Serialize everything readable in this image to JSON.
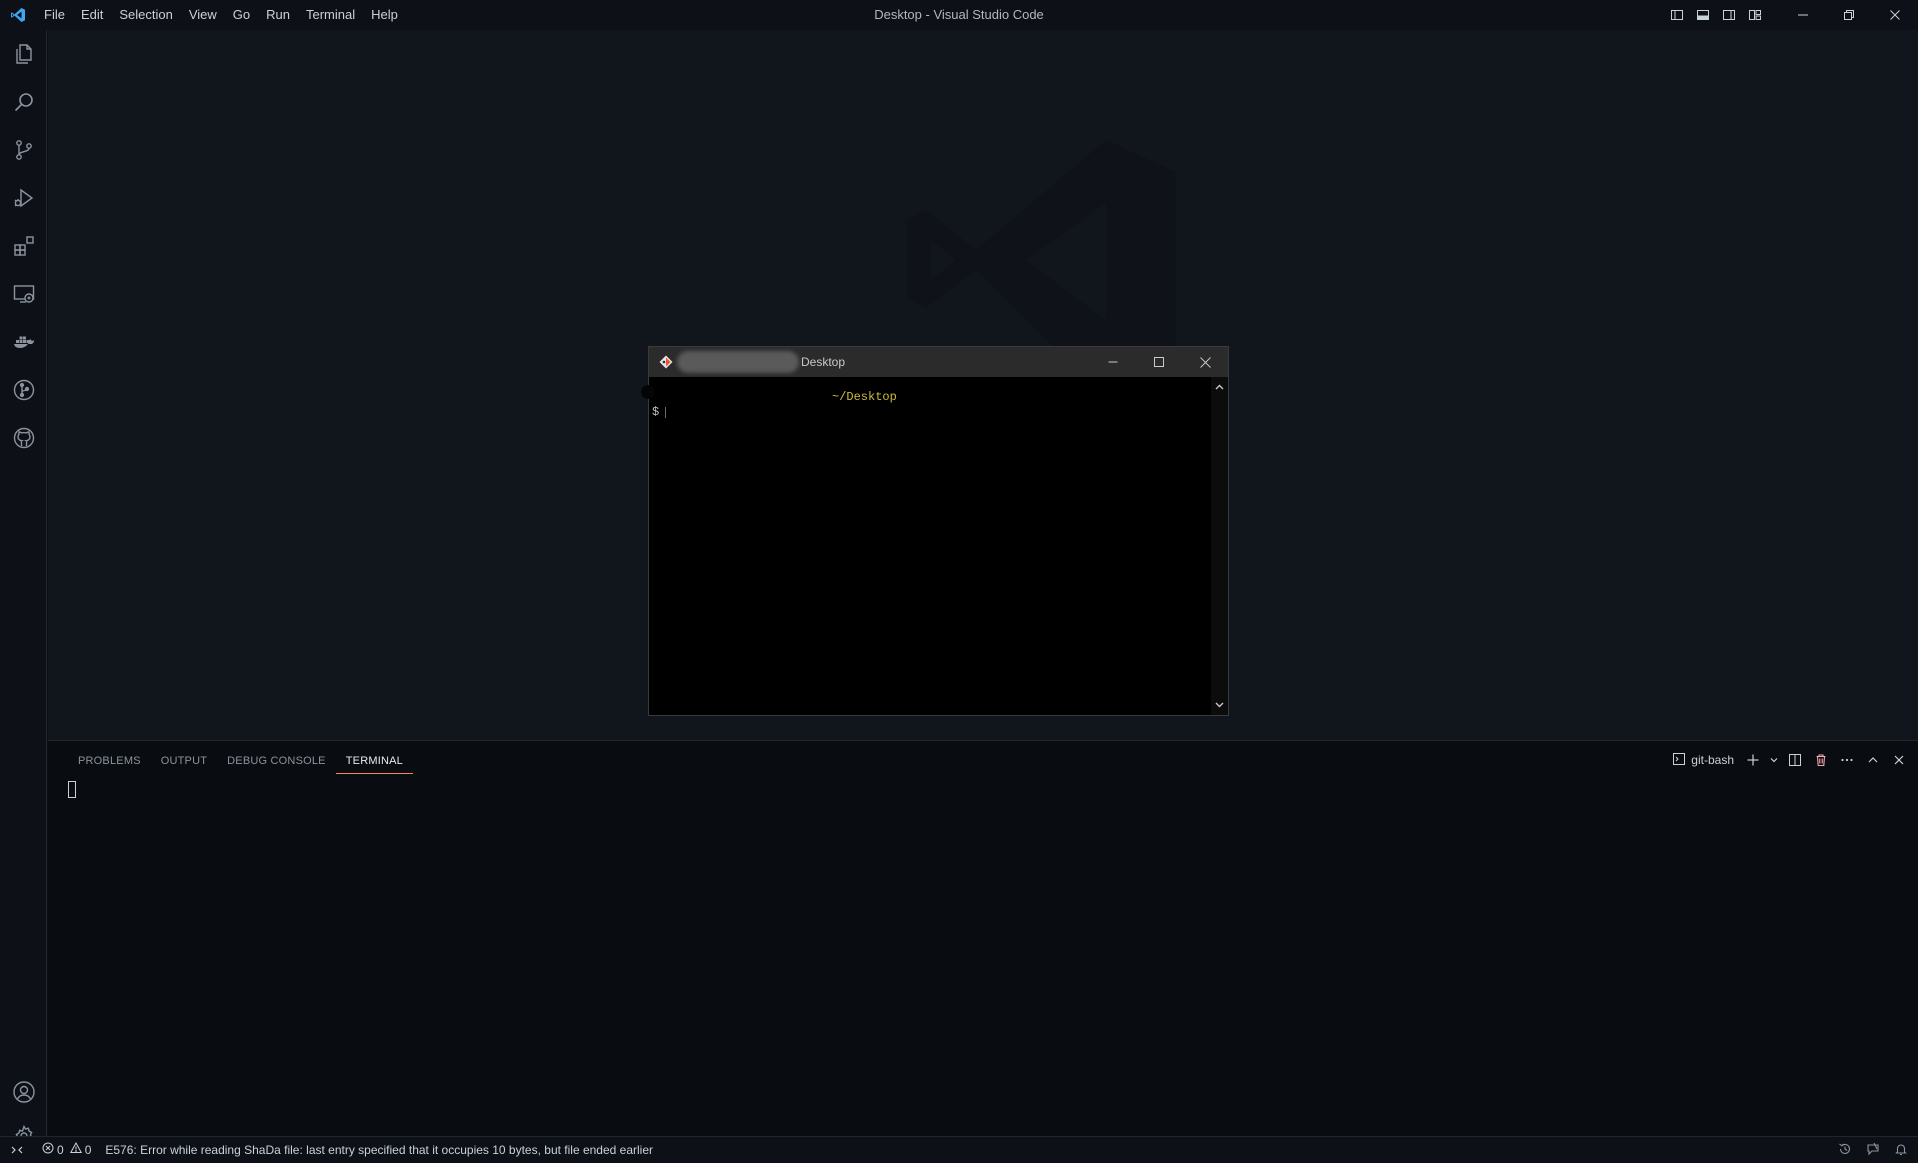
{
  "window": {
    "title": "Desktop - Visual Studio Code"
  },
  "menu": [
    "File",
    "Edit",
    "Selection",
    "View",
    "Go",
    "Run",
    "Terminal",
    "Help"
  ],
  "activity_bar": {
    "top": [
      "explorer-icon",
      "search-icon",
      "source-control-icon",
      "run-debug-icon",
      "extensions-icon",
      "remote-explorer-icon",
      "docker-icon",
      "git-graph-icon",
      "github-icon"
    ],
    "bottom": [
      "accounts-icon",
      "settings-gear-icon"
    ]
  },
  "panel": {
    "tabs": [
      "PROBLEMS",
      "OUTPUT",
      "DEBUG CONSOLE",
      "TERMINAL"
    ],
    "active_tab": "TERMINAL",
    "terminal_name": "git-bash"
  },
  "floating_terminal": {
    "title": "Desktop",
    "path": "~/Desktop",
    "prompt": "$"
  },
  "statusbar": {
    "errors": "0",
    "warnings": "0",
    "message": "E576: Error while reading ShaDa file: last entry specified that it occupies 10 bytes, but file ended earlier"
  },
  "colors": {
    "background": "#0d1117",
    "editor": "#11151c",
    "panel": "#090c10",
    "accent_tab_underline": "#f78166",
    "path_yellow": "#cdbd37"
  }
}
